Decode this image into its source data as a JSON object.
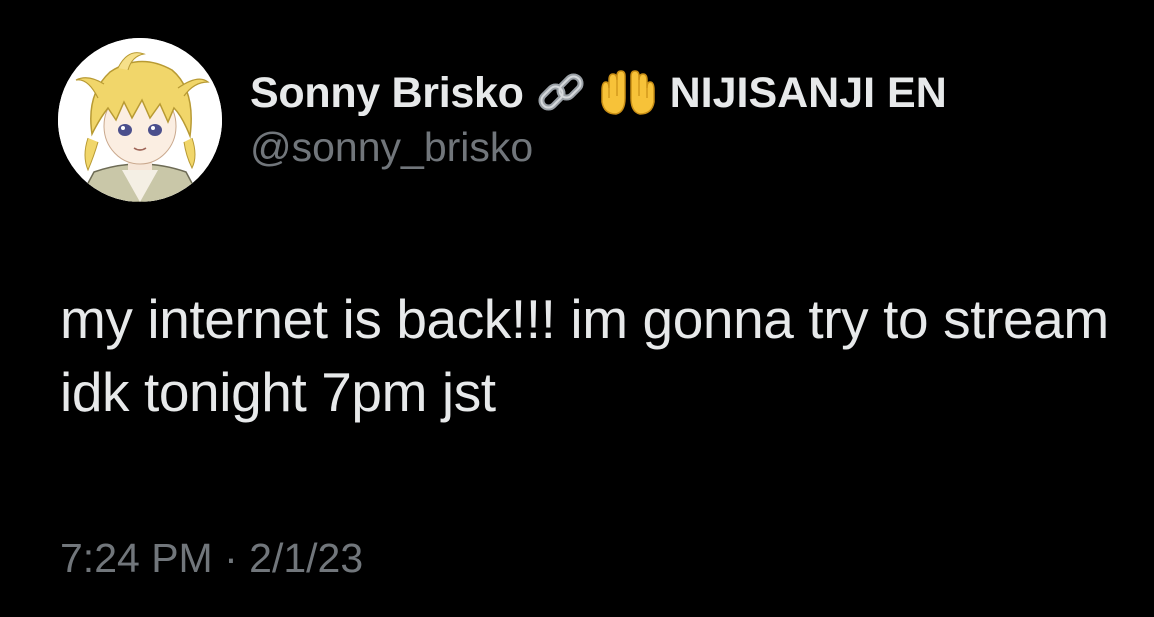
{
  "author": {
    "display_name": "Sonny Brisko",
    "badges": [
      "link-emoji-icon",
      "raising-hands-emoji-icon"
    ],
    "affiliation": "NIJISANJI EN",
    "handle": "@sonny_brisko",
    "avatar": "anime-avatar-blonde-hair"
  },
  "tweet": {
    "text": "my internet is back!!! im gonna try to stream idk tonight 7pm jst",
    "time": "7:24 PM",
    "separator": "·",
    "date": "2/1/23"
  },
  "colors": {
    "background": "#000000",
    "primary_text": "#e7e9ea",
    "secondary_text": "#71767b"
  }
}
